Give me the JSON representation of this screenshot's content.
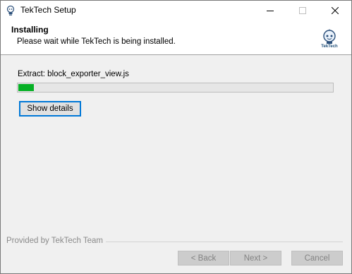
{
  "window": {
    "title": "TekTech Setup",
    "icons": {
      "app": "installer-icon",
      "minimize": "minimize-icon",
      "maximize": "maximize-icon",
      "close": "close-icon"
    }
  },
  "header": {
    "title": "Installing",
    "subtitle": "Please wait while TekTech is being installed.",
    "logo_text": "TekTech",
    "logo_icon": "lightbulb-robot-icon"
  },
  "progress": {
    "status_text": "Extract: block_exporter_view.js",
    "fraction": 0.05,
    "color": "#06b025"
  },
  "buttons": {
    "show_details": "Show details",
    "back": "< Back",
    "next": "Next >",
    "cancel": "Cancel"
  },
  "footer": {
    "branding": "Provided by TekTech Team"
  },
  "colors": {
    "accent": "#0078d7",
    "window_bg": "#f0f0f0"
  }
}
